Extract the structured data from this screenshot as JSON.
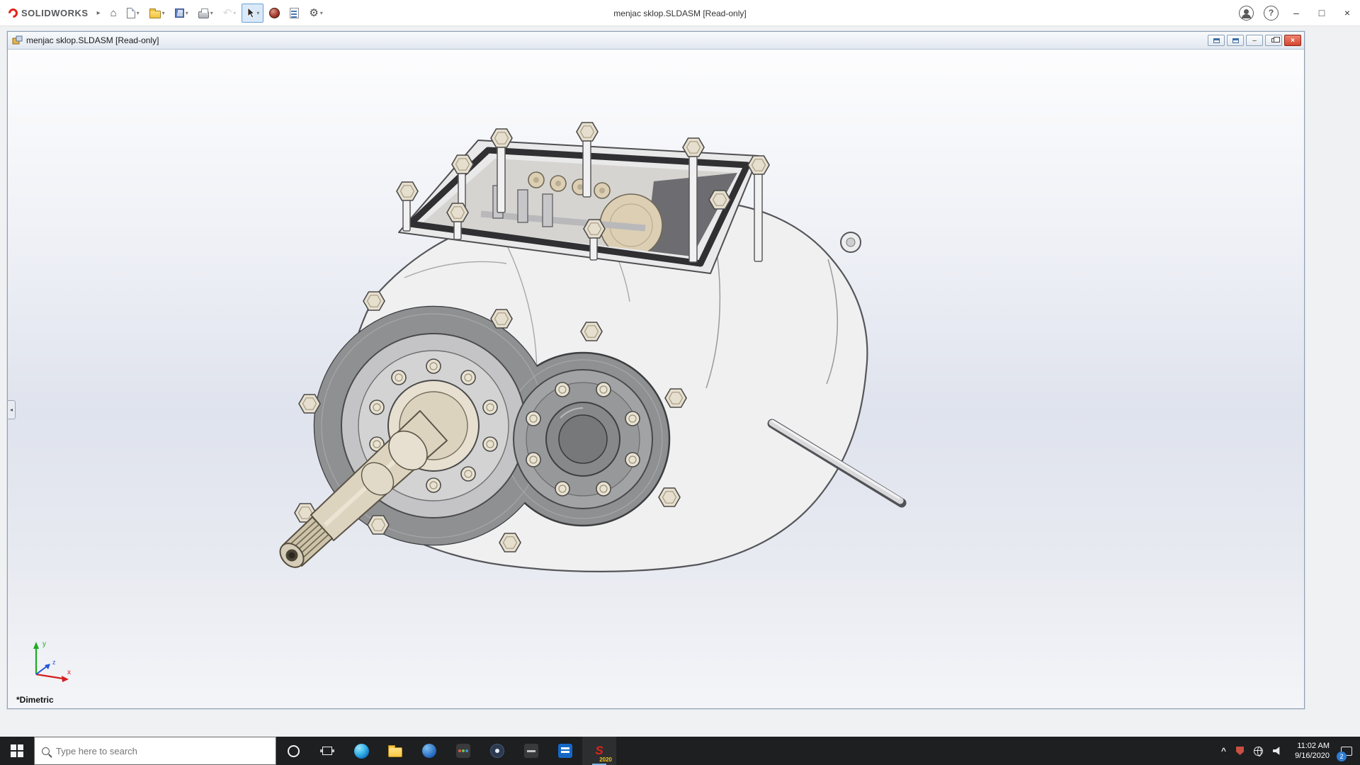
{
  "app": {
    "brand": "SOLIDWORKS",
    "title": "menjac sklop.SLDASM [Read-only]"
  },
  "doc": {
    "title": "menjac sklop.SLDASM [Read-only]"
  },
  "viewport": {
    "view_name": "*Dimetric",
    "triad": {
      "x": "x",
      "y": "y",
      "z": "z"
    }
  },
  "taskbar": {
    "search_placeholder": "Type here to search",
    "solidworks_year": "2020",
    "clock": {
      "time": "11:02 AM",
      "date": "9/16/2020"
    },
    "action_center_badge": "2"
  },
  "icons": {
    "flyout": "▸",
    "dropdown": "▾",
    "home": "⌂",
    "undo": "↶",
    "gear": "⚙",
    "help": "?",
    "minimize": "–",
    "maximize": "□",
    "close": "×",
    "collapse": "◂",
    "tray_caret": "^"
  },
  "colors": {
    "accent_red": "#e2231a",
    "taskbar_bg": "#1d1f21",
    "selection_highlight": "#d9e9f9"
  }
}
